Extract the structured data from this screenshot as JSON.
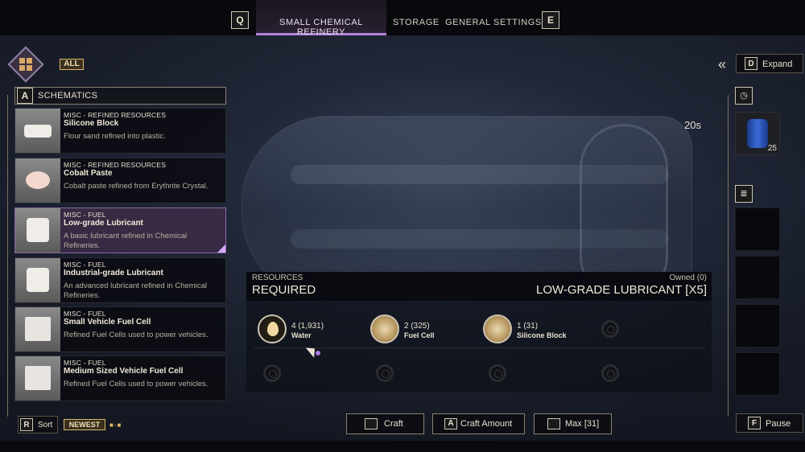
{
  "top_tabs": {
    "left_key": "Q",
    "right_key": "E",
    "tabs": [
      {
        "label": "SMALL CHEMICAL REFINERY",
        "active": true
      },
      {
        "label": "STORAGE",
        "active": false
      },
      {
        "label": "GENERAL SETTINGS",
        "active": false
      }
    ]
  },
  "filter": {
    "all_label": "ALL"
  },
  "schematics": {
    "header_key": "A",
    "header_label": "SCHEMATICS",
    "items": [
      {
        "category": "MISC - REFINED RESOURCES",
        "name": "Silicone Block",
        "desc": "Flour sand refined into plastic.",
        "icon": "silicone-block-icon"
      },
      {
        "category": "MISC - REFINED RESOURCES",
        "name": "Cobalt Paste",
        "desc": "Cobalt paste refined from Erythrite Crystal.",
        "icon": "cobalt-paste-icon"
      },
      {
        "category": "MISC - FUEL",
        "name": "Low-grade Lubricant",
        "desc": "A basic lubricant refined in Chemical Refineries.",
        "icon": "lubricant-icon",
        "selected": true
      },
      {
        "category": "MISC - FUEL",
        "name": "Industrial-grade Lubricant",
        "desc": "An advanced lubricant refined in Chemical Refineries.",
        "icon": "industrial-lubricant-icon"
      },
      {
        "category": "MISC - FUEL",
        "name": "Small Vehicle Fuel Cell",
        "desc": "Refined Fuel Cells used to power vehicles.",
        "icon": "fuel-cell-icon"
      },
      {
        "category": "MISC - FUEL",
        "name": "Medium Sized Vehicle Fuel Cell",
        "desc": "Refined Fuel Cells used to power vehicles.",
        "icon": "fuel-cell-icon"
      }
    ]
  },
  "sort": {
    "key": "R",
    "label": "Sort",
    "value": "NEWEST"
  },
  "resources": {
    "small_label": "RESOURCES",
    "big_label": "REQUIRED",
    "owned": "Owned (0)",
    "target": "LOW-GRADE LUBRICANT [X5]",
    "items": [
      {
        "qty": "4 (1,931)",
        "name": "Water",
        "icon": "water-drop-icon"
      },
      {
        "qty": "2 (325)",
        "name": "Fuel Cell",
        "icon": "fuel-cell-icon"
      },
      {
        "qty": "1 (31)",
        "name": "Silicone Block",
        "icon": "silicone-block-icon"
      }
    ]
  },
  "actions": {
    "craft": "Craft",
    "craft_amount_key": "A",
    "craft_amount": "Craft Amount",
    "max": "Max [31]"
  },
  "right_panel": {
    "expand_key": "D",
    "expand_label": "Expand",
    "timer": "20s",
    "output_qty": "25",
    "pause_key": "F",
    "pause_label": "Pause"
  },
  "colors": {
    "accent": "#b084d8",
    "gold": "#d8b868"
  }
}
